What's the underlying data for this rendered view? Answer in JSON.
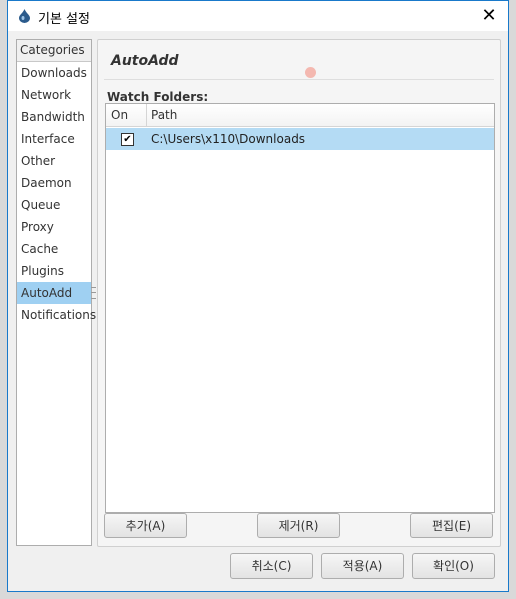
{
  "window": {
    "title": "기본 설정",
    "close_label": "✕"
  },
  "categories": {
    "header": "Categories",
    "items": [
      {
        "label": "Downloads"
      },
      {
        "label": "Network"
      },
      {
        "label": "Bandwidth"
      },
      {
        "label": "Interface"
      },
      {
        "label": "Other"
      },
      {
        "label": "Daemon"
      },
      {
        "label": "Queue"
      },
      {
        "label": "Proxy"
      },
      {
        "label": "Cache"
      },
      {
        "label": "Plugins"
      },
      {
        "label": "AutoAdd",
        "selected": true
      },
      {
        "label": "Notifications"
      }
    ]
  },
  "panel": {
    "title": "AutoAdd",
    "watch_folders_label": "Watch Folders:",
    "table": {
      "columns": [
        "On",
        "Path"
      ],
      "rows": [
        {
          "on": true,
          "check": "✔",
          "path": "C:\\Users\\x110\\Downloads"
        }
      ]
    },
    "buttons": {
      "add": "추가(A)",
      "remove": "제거(R)",
      "edit": "편집(E)"
    }
  },
  "footer": {
    "cancel": "취소(C)",
    "apply": "적용(A)",
    "ok": "확인(O)"
  },
  "colors": {
    "accent": "#1979ca",
    "selection": "#9fd0f2",
    "row_selection": "#b4dbf4"
  }
}
